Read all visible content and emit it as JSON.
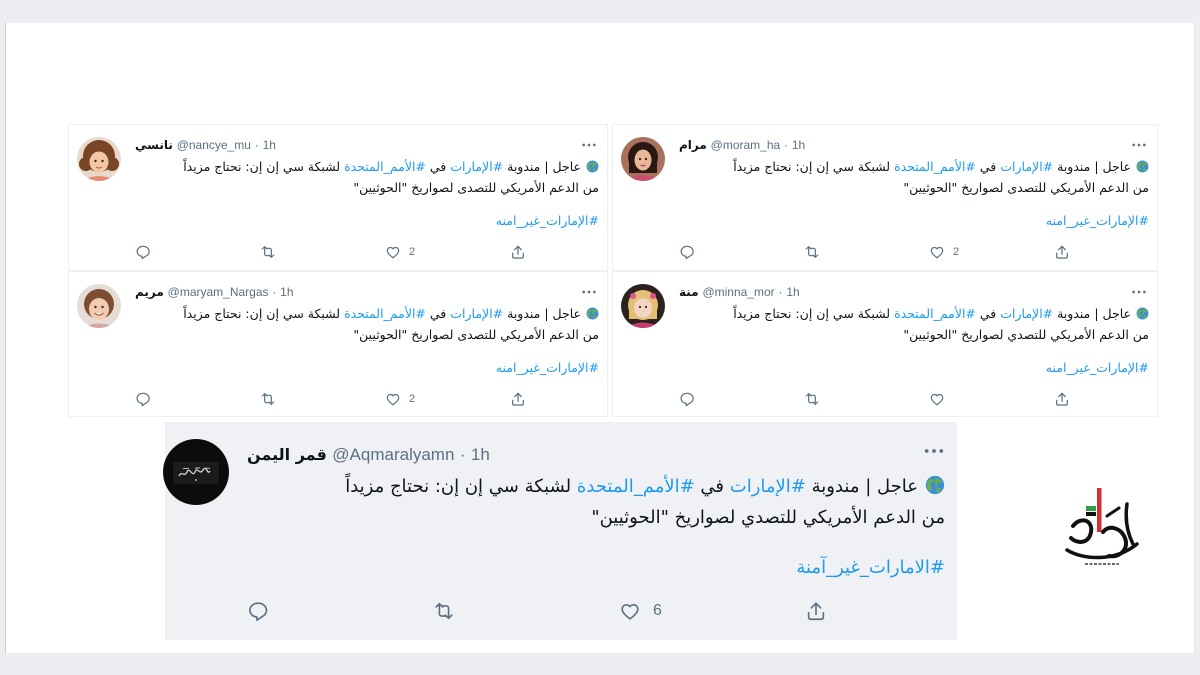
{
  "tweets": [
    {
      "name": "نانسي",
      "handle": "@nancye_mu",
      "separator": "·",
      "time": "1h",
      "text": {
        "part1": "عاجل | مندوبة",
        "hashtag1": "#الإمارات",
        "part2": "في",
        "hashtag2": "#الأمم_المتحدة",
        "part3": "لشبكة سي إن إن: نحتاج مزيداً",
        "line2": "من الدعم الأمريكي للتصدى لصواريخ \"الحوثيين\""
      },
      "hashtag": "#الإمارات_غير_امنه",
      "likes": "2"
    },
    {
      "name": "مرام",
      "handle": "@moram_ha",
      "separator": "·",
      "time": "1h",
      "text": {
        "part1": "عاجل | مندوبة",
        "hashtag1": "#الإمارات",
        "part2": "في",
        "hashtag2": "#الأمم_المتحدة",
        "part3": "لشبكة سي إن إن: نحتاج مزيداً",
        "line2": "من الدعم الأمريكي للتصدى لصواريخ \"الحوثيين\""
      },
      "hashtag": "#الإمارات_غير_امنه",
      "likes": "2"
    },
    {
      "name": "مريم",
      "handle": "@maryam_Nargas",
      "separator": "·",
      "time": "1h",
      "text": {
        "part1": "عاجل | مندوبة",
        "hashtag1": "#الإمارات",
        "part2": "في",
        "hashtag2": "#الأمم_المتحدة",
        "part3": "لشبكة سي إن إن: نحتاج مزيداً",
        "line2": "من الدعم الأمريكي للتصدى لصواريخ \"الحوثيين\""
      },
      "hashtag": "#الإمارات_غير_امنه",
      "likes": "2"
    },
    {
      "name": "منة",
      "handle": "@minna_mor",
      "separator": "·",
      "time": "1h",
      "text": {
        "part1": "عاجل | مندوبة",
        "hashtag1": "#الإمارات",
        "part2": "في",
        "hashtag2": "#الأمم_المتحدة",
        "part3": "لشبكة سي إن إن: نحتاج مزيداً",
        "line2": "من الدعم الأمريكي للتصدي لصواريخ \"الحوثيين\""
      },
      "hashtag": "#الإمارات_غير_امنه"
    }
  ],
  "featured_tweet": {
    "name": "قمر اليمن",
    "handle": "@Aqmaralyamn",
    "separator": "·",
    "time": "1h",
    "text": {
      "part1": "عاجل | مندوبة",
      "hashtag1": "#الإمارات",
      "part2": "في",
      "hashtag2": "#الأمم_المتحدة",
      "part3": "لشبكة سي إن إن: نحتاج مزيداً",
      "line2": "من الدعم الأمريكي للتصدي لصواريخ \"الحوثيين\""
    },
    "hashtag": "#الامارات_غير_آمنة",
    "likes": "6"
  },
  "icons": {
    "text_prefix": "globe-icon",
    "menu": "more-options-icon",
    "actions": [
      "reply-icon",
      "retweet-icon",
      "like-icon",
      "share-icon"
    ],
    "watermark": "brand-logo"
  },
  "colors": {
    "hashtag": "#1d9bf0",
    "icon": "#5b7083",
    "featured_background": "#eff1f4",
    "logo_red": "#d32f2f",
    "logo_green": "#2e9e46"
  }
}
